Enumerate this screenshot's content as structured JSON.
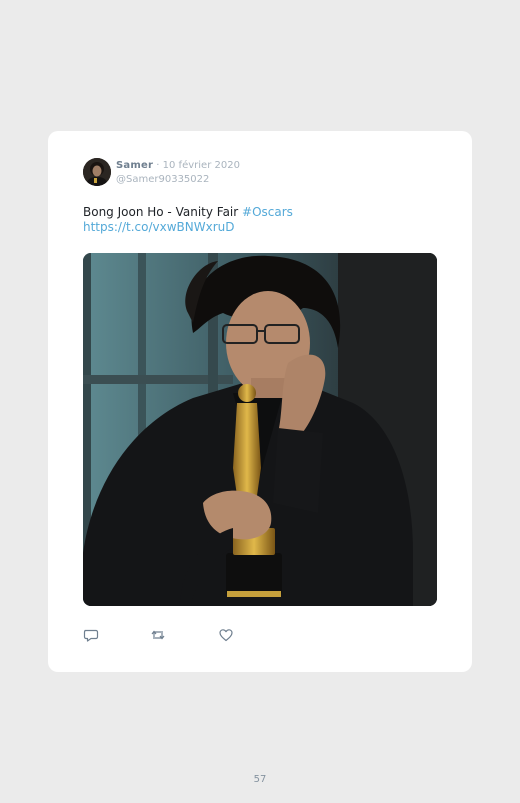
{
  "tweet": {
    "author_name": "Samer",
    "separator": "·",
    "date": "10 février 2020",
    "handle": "@Samer90335022",
    "text": "Bong Joon Ho - Vanity Fair ",
    "hashtag": "#Oscars",
    "link": "https://t.co/vxwBNWxruD"
  },
  "actions": {
    "reply_icon": "comment-icon",
    "retweet_icon": "retweet-icon",
    "like_icon": "heart-icon"
  },
  "page": {
    "number": "57"
  },
  "colors": {
    "background": "#ebebeb",
    "card": "#ffffff",
    "link": "#54a9d8",
    "muted": "#aab4be"
  }
}
